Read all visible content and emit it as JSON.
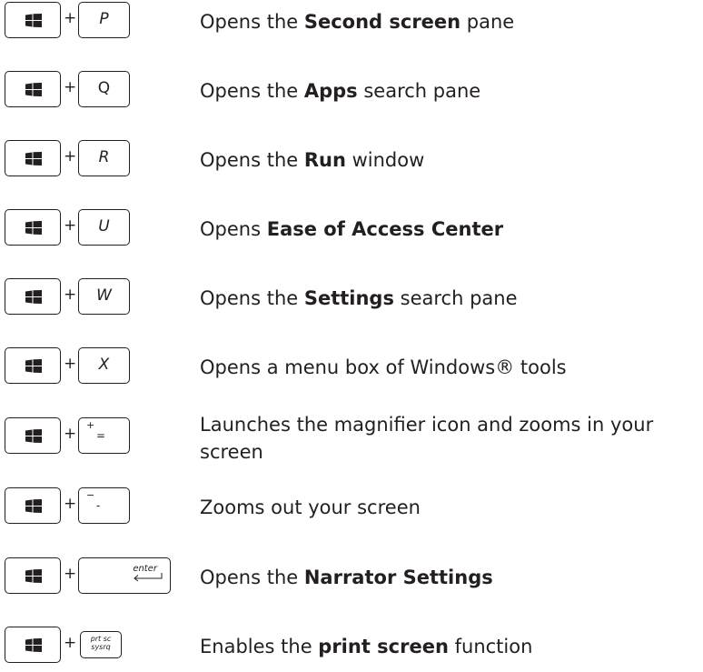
{
  "shortcuts": [
    {
      "key": "P",
      "pre": "Opens the ",
      "bold": "Second screen",
      "post": " pane"
    },
    {
      "key": "Q",
      "pre": "Opens the ",
      "bold": "Apps",
      "post": " search pane"
    },
    {
      "key": "R",
      "pre": "Opens the ",
      "bold": "Run",
      "post": " window"
    },
    {
      "key": "U",
      "pre": "Opens ",
      "bold": "Ease of Access Center",
      "post": ""
    },
    {
      "key": "W",
      "pre": "Opens the ",
      "bold": "Settings",
      "post": " search pane"
    },
    {
      "key": "X",
      "pre": "Opens a menu box of Windows® tools",
      "bold": "",
      "post": ""
    },
    {
      "key_top": "+",
      "key_main": "=",
      "pre": "Launches the magnifier icon and zooms in your screen",
      "bold": "",
      "post": ""
    },
    {
      "key_top": "−",
      "key_main": "-",
      "pre": "Zooms out your screen",
      "bold": "",
      "post": ""
    },
    {
      "key": "enter",
      "pre": "Opens the ",
      "bold": "Narrator Settings",
      "post": ""
    },
    {
      "key_line1": "prt sc",
      "key_line2": "sysrq",
      "pre": "Enables the ",
      "bold": "print screen",
      "post": " function"
    }
  ],
  "plus_sign": "+",
  "icons": {
    "windows_key": "windows-logo-icon",
    "enter_arrow": "enter-arrow-icon"
  }
}
